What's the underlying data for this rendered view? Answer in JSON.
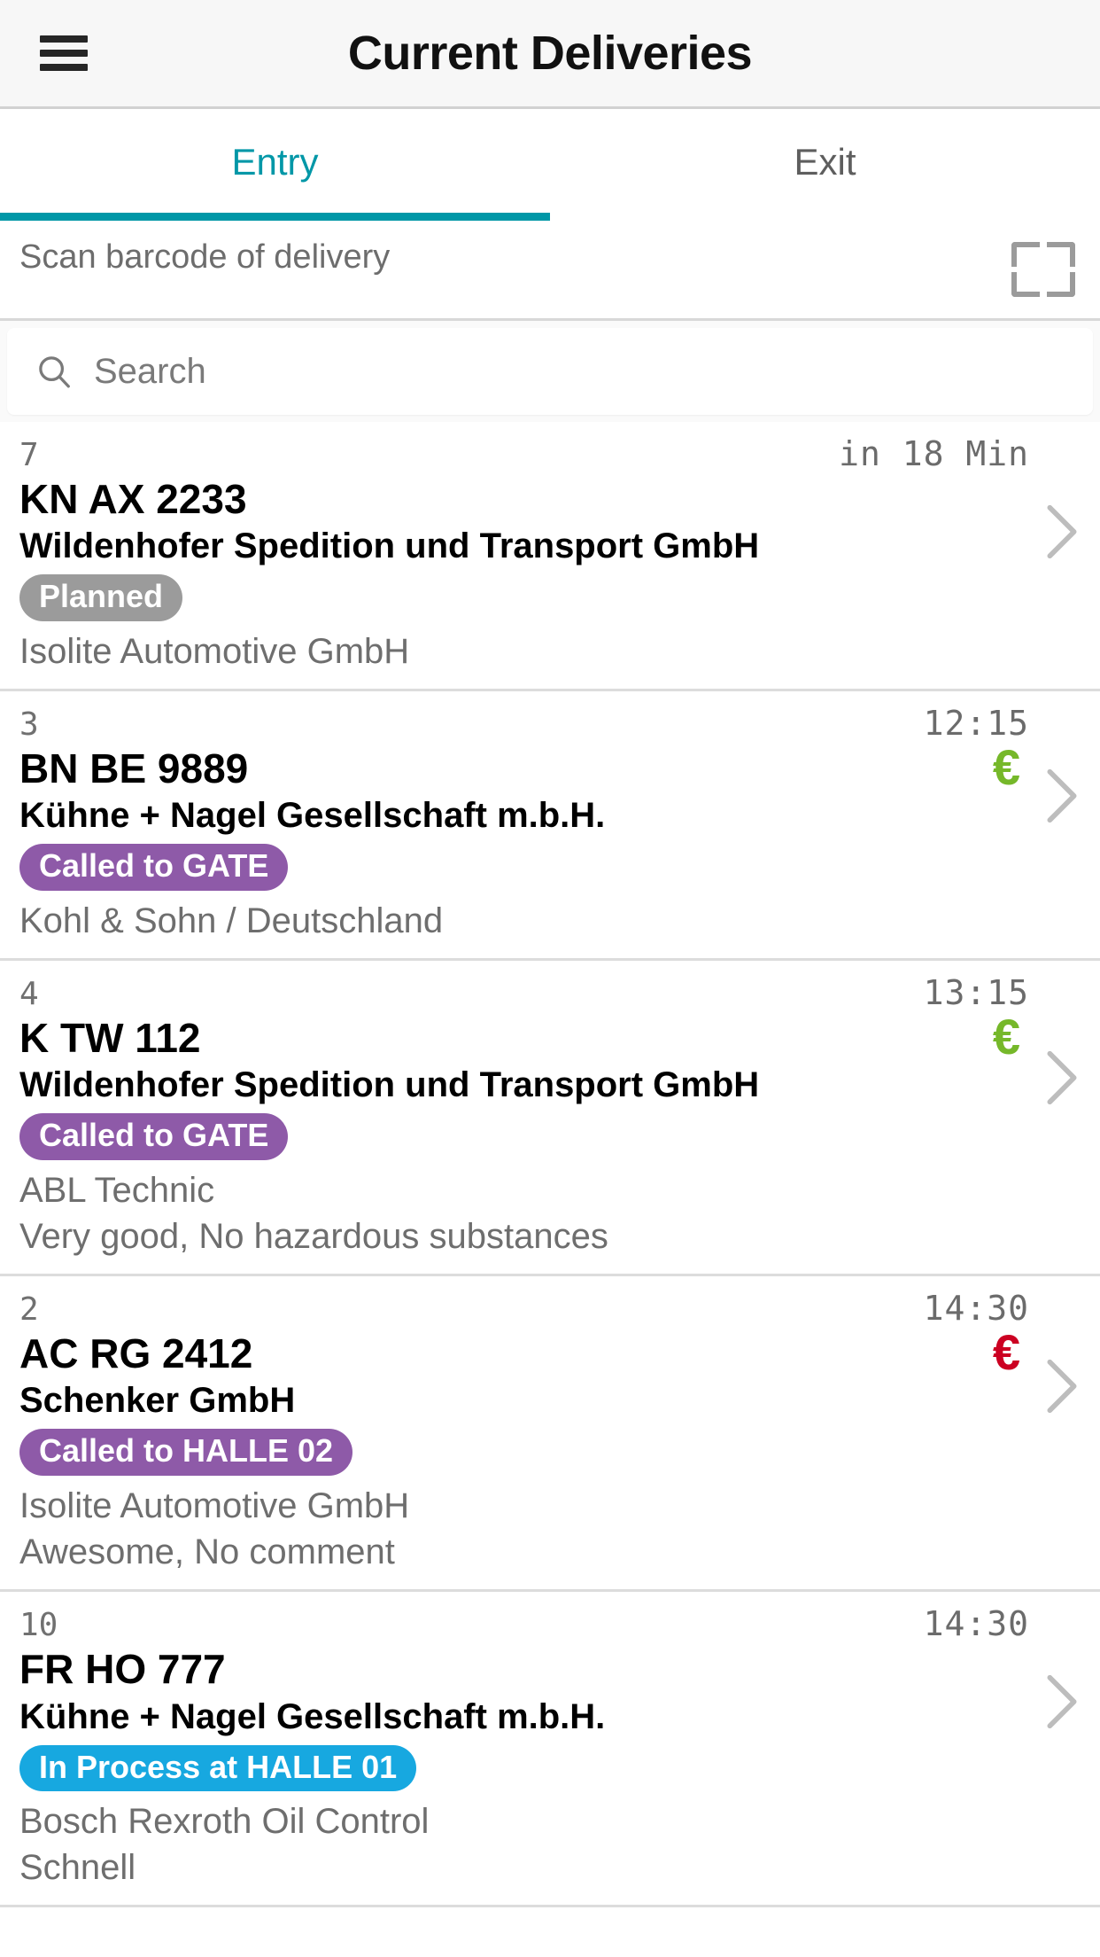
{
  "appbar": {
    "title": "Current Deliveries",
    "menu_icon": "hamburger-menu-icon"
  },
  "tabs": {
    "items": [
      {
        "label": "Entry",
        "active": true
      },
      {
        "label": "Exit",
        "active": false
      }
    ],
    "active_color": "#0097a7",
    "inactive_color": "#5e5e5e"
  },
  "scan": {
    "label": "Scan barcode of delivery",
    "icon": "barcode-scanner-frame-icon"
  },
  "search": {
    "placeholder": "Search",
    "value": "",
    "icon": "search-icon"
  },
  "colors": {
    "accent": "#0097a7",
    "badge_gray": "#9b9b9b",
    "badge_purple": "#8e5aa8",
    "badge_blue": "#17a8e0",
    "euro_green": "#76b82a",
    "euro_red": "#cc0022"
  },
  "deliveries": [
    {
      "seq": "7",
      "time": "in 18 Min",
      "plate": "KN AX 2233",
      "carrier": "Wildenhofer Spedition und Transport GmbH",
      "status": "Planned",
      "status_color": "gray",
      "customer": "Isolite Automotive GmbH",
      "note": "",
      "euro": "",
      "euro_color": ""
    },
    {
      "seq": "3",
      "time": "12:15",
      "plate": "BN BE 9889",
      "carrier": "Kühne + Nagel Gesellschaft m.b.H.",
      "status": "Called to GATE",
      "status_color": "purple",
      "customer": "Kohl & Sohn / Deutschland",
      "note": "",
      "euro": "€",
      "euro_color": "#76b82a"
    },
    {
      "seq": "4",
      "time": "13:15",
      "plate": "K TW 112",
      "carrier": "Wildenhofer Spedition und Transport GmbH",
      "status": "Called to GATE",
      "status_color": "purple",
      "customer": "ABL Technic",
      "note": "Very good, No hazardous substances",
      "euro": "€",
      "euro_color": "#76b82a"
    },
    {
      "seq": "2",
      "time": "14:30",
      "plate": "AC RG 2412",
      "carrier": "Schenker GmbH",
      "status": "Called to HALLE 02",
      "status_color": "purple",
      "customer": "Isolite Automotive GmbH",
      "note": "Awesome, No comment",
      "euro": "€",
      "euro_color": "#cc0022"
    },
    {
      "seq": "10",
      "time": "14:30",
      "plate": "FR HO 777",
      "carrier": "Kühne + Nagel Gesellschaft m.b.H.",
      "status": "In Process at HALLE 01",
      "status_color": "blue",
      "customer": "Bosch Rexroth Oil Control",
      "note": "Schnell",
      "euro": "",
      "euro_color": ""
    }
  ]
}
